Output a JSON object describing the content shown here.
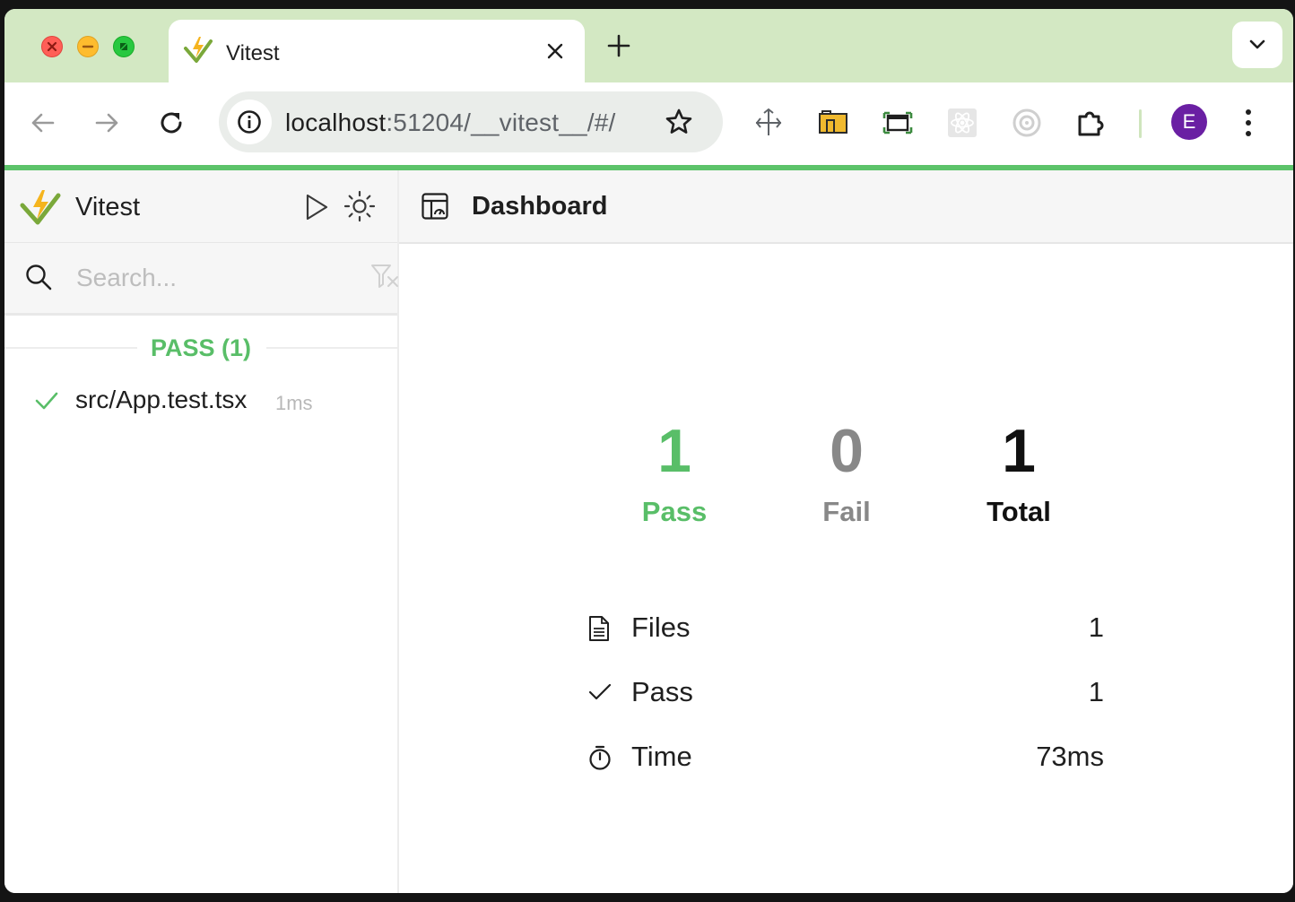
{
  "browser": {
    "tab": {
      "title": "Vitest"
    },
    "url": {
      "host": "localhost",
      "path": ":51204/__vitest__/#/"
    },
    "profile_initial": "E",
    "extensions": [
      "move-extension-icon",
      "folder-extension-icon",
      "window-extension-icon",
      "react-devtools-icon",
      "target-extension-icon",
      "extensions-puzzle-icon"
    ],
    "colors": {
      "tabstrip": "#d3e8c3",
      "progress": "#5cc36a",
      "avatar": "#6a1fa3"
    }
  },
  "sidebar": {
    "title": "Vitest",
    "search_placeholder": "Search...",
    "group_label": "PASS (1)",
    "files": [
      {
        "name": "src/App.test.tsx",
        "duration": "1ms",
        "status": "pass"
      }
    ]
  },
  "main": {
    "title": "Dashboard",
    "summary": [
      {
        "value": "1",
        "label": "Pass",
        "color": "#59be68"
      },
      {
        "value": "0",
        "label": "Fail",
        "color": "#888888"
      },
      {
        "value": "1",
        "label": "Total",
        "color": "#111111"
      }
    ],
    "metrics": [
      {
        "icon": "file-icon",
        "label": "Files",
        "value": "1"
      },
      {
        "icon": "check-icon",
        "label": "Pass",
        "value": "1"
      },
      {
        "icon": "timer-icon",
        "label": "Time",
        "value": "73ms"
      }
    ]
  }
}
